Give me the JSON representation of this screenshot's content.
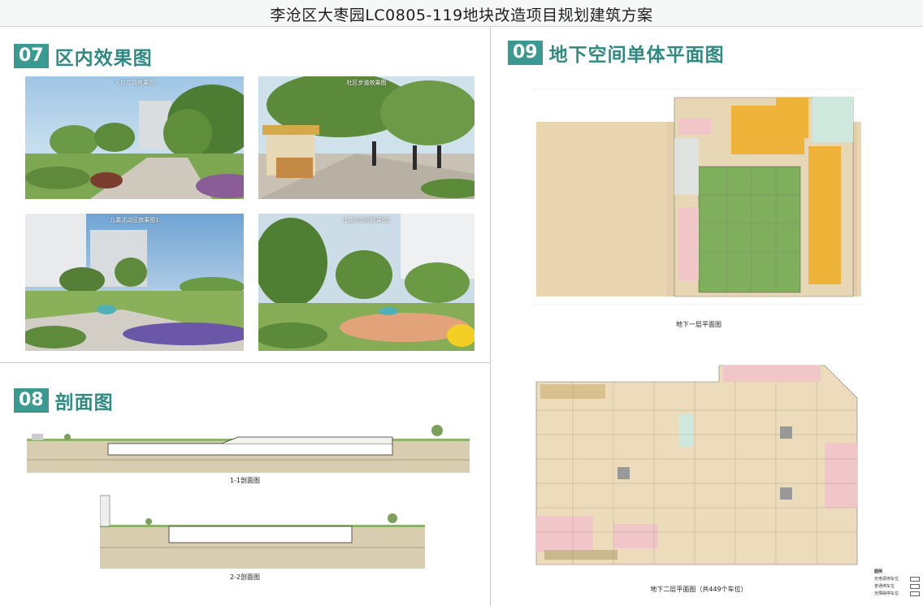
{
  "header": {
    "title": "李沧区大枣园LC0805-119地块改造项目规划建筑方案"
  },
  "section07": {
    "num": "07",
    "title": "区内效果图",
    "photos": [
      "入口广场效果图",
      "社区步道效果图",
      "儿童活动区效果图1",
      "儿童活动区效果图2"
    ]
  },
  "section08": {
    "num": "08",
    "title": "剖面图",
    "captions": [
      "1-1剖面图",
      "2-2剖面图"
    ]
  },
  "section09": {
    "num": "09",
    "title": "地下空间单体平面图",
    "captions": [
      "地下一层平面图",
      "地下二层平面图（共449个车位）"
    ],
    "legend": [
      "图例",
      "无电源停车位",
      "普通停车位",
      "无障碍停车位"
    ]
  },
  "colors": {
    "accent": "#3a9a92",
    "orange": "#f0b33a",
    "green": "#7fae5c",
    "tan": "#ead7b0",
    "pink": "#f0c6c8"
  }
}
